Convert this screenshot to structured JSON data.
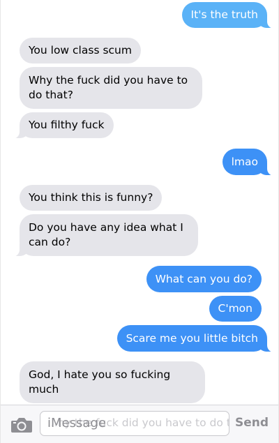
{
  "messages": [
    {
      "dir": "out",
      "text": "It's the truth"
    },
    {
      "dir": "in",
      "text": "You low class scum"
    },
    {
      "dir": "in",
      "text": "Why the fuck did you have to do that?"
    },
    {
      "dir": "in",
      "text": "You filthy fuck"
    },
    {
      "dir": "out",
      "text": "lmao"
    },
    {
      "dir": "in",
      "text": "You think this is funny?"
    },
    {
      "dir": "in",
      "text": "Do you have any idea what I can do?"
    },
    {
      "dir": "out",
      "text": "What can you do?"
    },
    {
      "dir": "out",
      "text": "C'mon"
    },
    {
      "dir": "out",
      "text": "Scare me you little bitch"
    },
    {
      "dir": "in",
      "text": "God, I hate you so fucking much"
    }
  ],
  "input": {
    "placeholder": "iMessage",
    "ghost_text": "...hy the fuck did you have to do that?",
    "send_label": "Send"
  },
  "icons": {
    "camera": "camera-icon"
  },
  "colors": {
    "incoming_bubble": "#e5e5ea",
    "outgoing_bubble": "#3d91f6",
    "outgoing_bubble_light": "#5ab2f7"
  }
}
